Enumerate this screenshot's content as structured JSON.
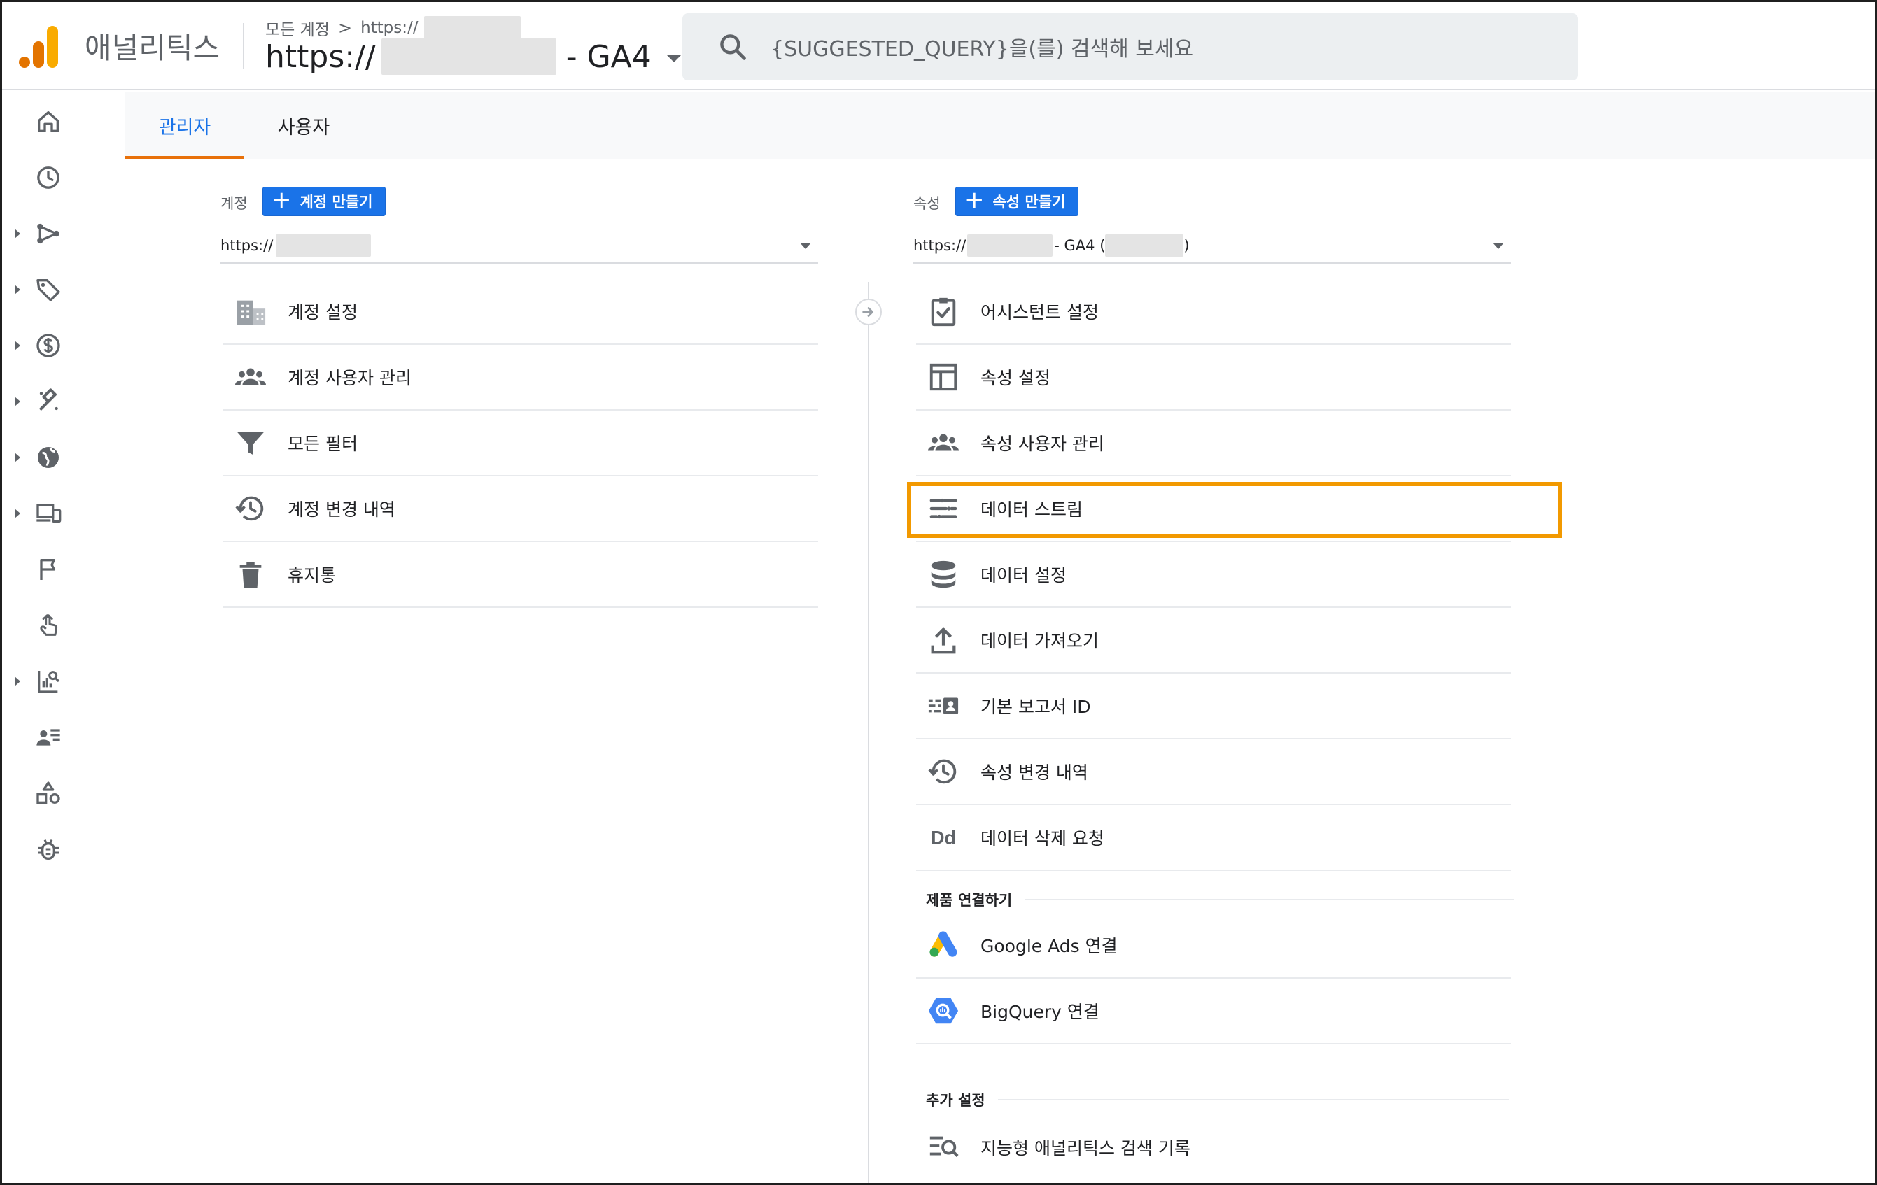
{
  "header": {
    "app_name": "애널리틱스",
    "breadcrumb_root": "모든 계정",
    "breadcrumb_separator": ">",
    "breadcrumb_account": "https://",
    "property_prefix": "https://",
    "property_suffix": "- GA4",
    "search_placeholder": "{SUGGESTED_QUERY}을(를) 검색해 보세요"
  },
  "rail": [
    {
      "icon": "home-icon",
      "expandable": false
    },
    {
      "icon": "clock-icon",
      "expandable": false
    },
    {
      "icon": "share-nodes-icon",
      "expandable": true
    },
    {
      "icon": "tag-icon",
      "expandable": true
    },
    {
      "icon": "dollar-icon",
      "expandable": true
    },
    {
      "icon": "magnet-icon",
      "expandable": true
    },
    {
      "icon": "globe-icon",
      "expandable": true
    },
    {
      "icon": "devices-icon",
      "expandable": true
    },
    {
      "icon": "flag-icon",
      "expandable": false
    },
    {
      "icon": "touch-icon",
      "expandable": false
    },
    {
      "icon": "report-search-icon",
      "expandable": true
    },
    {
      "icon": "user-list-icon",
      "expandable": false
    },
    {
      "icon": "shapes-icon",
      "expandable": false
    },
    {
      "icon": "bug-icon",
      "expandable": false
    }
  ],
  "tabs": {
    "admin": "관리자",
    "user": "사용자"
  },
  "account": {
    "label": "계정",
    "create_button": "계정 만들기",
    "selected": "https://",
    "items": [
      {
        "icon": "building-icon",
        "label": "계정 설정"
      },
      {
        "icon": "people-icon",
        "label": "계정 사용자 관리"
      },
      {
        "icon": "filter-icon",
        "label": "모든 필터"
      },
      {
        "icon": "history-icon",
        "label": "계정 변경 내역"
      },
      {
        "icon": "trash-icon",
        "label": "휴지통"
      }
    ]
  },
  "property": {
    "label": "속성",
    "create_button": "속성 만들기",
    "selected_prefix": "https://",
    "selected_mid": "- GA4 (",
    "selected_suffix": ")",
    "items": [
      {
        "icon": "checklist-icon",
        "label": "어시스턴트 설정"
      },
      {
        "icon": "layout-icon",
        "label": "속성 설정"
      },
      {
        "icon": "people-icon",
        "label": "속성 사용자 관리"
      },
      {
        "icon": "data-streams-icon",
        "label": "데이터 스트림"
      },
      {
        "icon": "database-icon",
        "label": "데이터 설정"
      },
      {
        "icon": "upload-icon",
        "label": "데이터 가져오기"
      },
      {
        "icon": "report-id-icon",
        "label": "기본 보고서 ID"
      },
      {
        "icon": "history-icon",
        "label": "속성 변경 내역"
      },
      {
        "icon": "dd-icon",
        "label": "데이터 삭제 요청"
      }
    ],
    "product_links_heading": "제품 연결하기",
    "product_links": [
      {
        "icon": "google-ads-icon",
        "label": "Google Ads 연결"
      },
      {
        "icon": "bigquery-icon",
        "label": "BigQuery 연결"
      }
    ],
    "extra_heading": "추가 설정",
    "extra": [
      {
        "icon": "search-history-icon",
        "label": "지능형 애널리틱스 검색 기록"
      }
    ]
  },
  "colors": {
    "accent": "#1a73e8",
    "highlight": "#f29900",
    "tab_indicator": "#e8710a"
  }
}
